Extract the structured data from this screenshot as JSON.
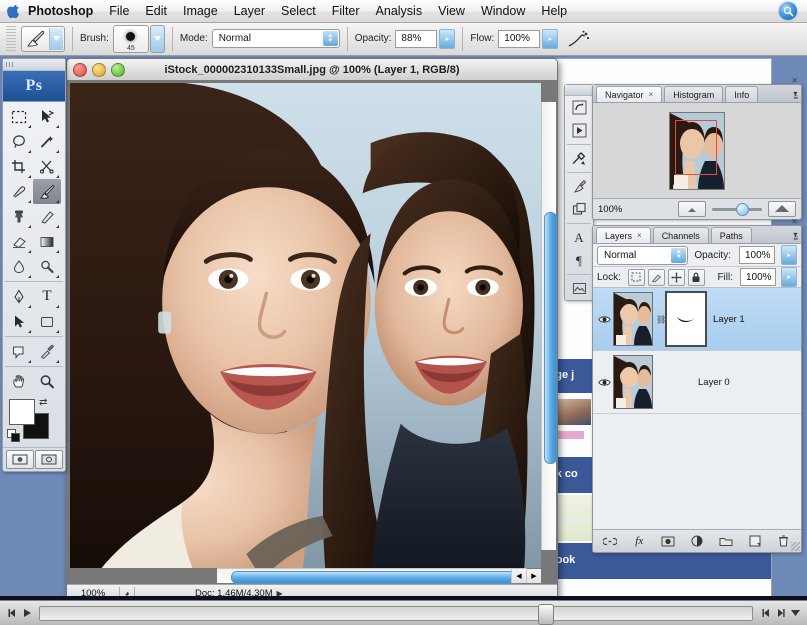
{
  "menubar": {
    "apple_icon": "apple-icon",
    "items": [
      "Photoshop",
      "File",
      "Edit",
      "Image",
      "Layer",
      "Select",
      "Filter",
      "Analysis",
      "View",
      "Window",
      "Help"
    ],
    "spotlight_icon": "search-icon"
  },
  "options_bar": {
    "tool_icon": "brush-tool-icon",
    "tool_preset_dropdown": "chevron-down-icon",
    "brush_label": "Brush:",
    "brush_size": "45",
    "brush_preview_icon": "soft-round-brush-icon",
    "mode_label": "Mode:",
    "mode_value": "Normal",
    "opacity_label": "Opacity:",
    "opacity_value": "88%",
    "flow_label": "Flow:",
    "flow_value": "100%",
    "airbrush_icon": "airbrush-icon"
  },
  "toolbox": {
    "logo": "Ps",
    "tools": [
      {
        "name": "marquee-tool",
        "glyph": "⬚"
      },
      {
        "name": "move-tool",
        "glyph": "➤"
      },
      {
        "name": "lasso-tool",
        "glyph": "◯"
      },
      {
        "name": "magic-wand-tool",
        "glyph": "✦"
      },
      {
        "name": "crop-tool",
        "glyph": "⌗"
      },
      {
        "name": "slice-tool",
        "glyph": "✂"
      },
      {
        "name": "healing-brush-tool",
        "glyph": "✒"
      },
      {
        "name": "brush-tool",
        "glyph": "🖌",
        "selected": true
      },
      {
        "name": "clone-stamp-tool",
        "glyph": "♣"
      },
      {
        "name": "history-brush-tool",
        "glyph": "✎"
      },
      {
        "name": "eraser-tool",
        "glyph": "◻"
      },
      {
        "name": "gradient-tool",
        "glyph": "▮"
      },
      {
        "name": "blur-tool",
        "glyph": "◌"
      },
      {
        "name": "dodge-tool",
        "glyph": "✋"
      },
      {
        "name": "pen-tool",
        "glyph": "✑"
      },
      {
        "name": "type-tool",
        "glyph": "T"
      },
      {
        "name": "path-selection-tool",
        "glyph": "➤"
      },
      {
        "name": "rectangle-tool",
        "glyph": "▭"
      },
      {
        "name": "notes-tool",
        "glyph": "🗒"
      },
      {
        "name": "eyedropper-tool",
        "glyph": "⚲"
      },
      {
        "name": "hand-tool",
        "glyph": "✍"
      },
      {
        "name": "zoom-tool",
        "glyph": "⌕"
      }
    ],
    "foreground_color": "#ffffff",
    "background_color": "#111111",
    "swap_icon": "swap-colors-icon",
    "default_colors_icon": "default-colors-icon",
    "quickmask_icons": [
      "standard-mode-icon",
      "quickmask-mode-icon"
    ]
  },
  "document": {
    "title": "iStock_000002310133Small.jpg @ 100% (Layer 1, RGB/8)",
    "close_button": "close-icon",
    "minimize_button": "minimize-icon",
    "zoom_button": "maximize-icon",
    "status_zoom": "100%",
    "status_icon": "doc-info-icon",
    "status_doc": "Doc: 1.46M/4.30M",
    "status_arrow": "▶"
  },
  "icon_dock": {
    "buttons": [
      "history-panel-icon",
      "actions-panel-icon",
      "tools-preset-icon",
      "brushes-panel-icon",
      "clone-source-icon",
      "character-panel-icon",
      "paragraph-panel-icon",
      "layer-comps-icon"
    ]
  },
  "navigator_panel": {
    "tabs": [
      {
        "label": "Navigator",
        "active": true,
        "close": "×"
      },
      {
        "label": "Histogram",
        "active": false
      },
      {
        "label": "Info",
        "active": false
      }
    ],
    "menu_icon": "panel-menu-icon",
    "close_icon": "close-icon",
    "zoom_value": "100%",
    "zoom_out_icon": "zoom-out-icon",
    "zoom_in_icon": "zoom-in-icon",
    "view_box_color": "#e34b3f"
  },
  "layers_panel": {
    "tabs": [
      {
        "label": "Layers",
        "active": true,
        "close": "×"
      },
      {
        "label": "Channels",
        "active": false
      },
      {
        "label": "Paths",
        "active": false
      }
    ],
    "menu_icon": "panel-menu-icon",
    "close_icon": "close-icon",
    "blend_mode": "Normal",
    "opacity_label": "Opacity:",
    "opacity_value": "100%",
    "lock_label": "Lock:",
    "lock_icons": [
      "lock-transparency-icon",
      "lock-image-icon",
      "lock-position-icon",
      "lock-all-icon"
    ],
    "fill_label": "Fill:",
    "fill_value": "100%",
    "layers": [
      {
        "name": "Layer 1",
        "visible": true,
        "selected": true,
        "has_mask": true,
        "link_icon": "link-icon",
        "eye_icon": "eye-icon"
      },
      {
        "name": "Layer 0",
        "visible": true,
        "selected": false,
        "has_mask": false,
        "eye_icon": "eye-icon"
      }
    ],
    "footer_buttons": [
      "link-layers-icon",
      "fx",
      "add-mask-icon",
      "adjustment-layer-icon",
      "new-group-icon",
      "new-layer-icon",
      "delete-layer-icon"
    ]
  },
  "background_page": {
    "bar_texts": [
      "rge j",
      "ok co",
      "book"
    ]
  },
  "player_bar": {
    "step_back_icon": "step-back-icon",
    "play_icon": "play-icon",
    "prev_icon": "prev-icon",
    "next_icon": "next-icon",
    "menu_icon": "chevron-down-icon",
    "progress_percent": "70"
  }
}
